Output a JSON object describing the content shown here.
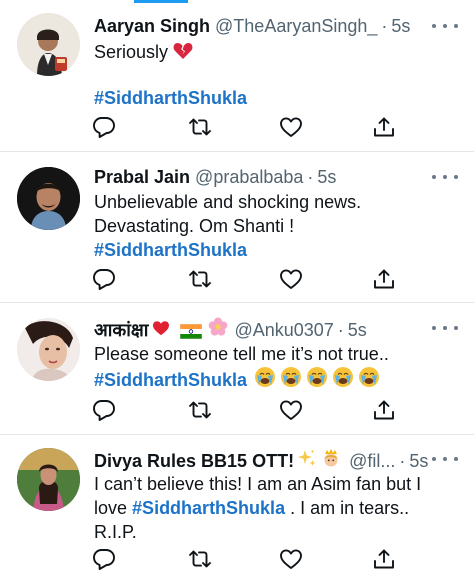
{
  "tweets": [
    {
      "name": "Aaryan Singh",
      "handle": "@TheAaryanSingh_",
      "time": "5s",
      "line1": "Seriously",
      "hashtag": "#SiddharthShukla",
      "avatar": "avatar-photo"
    },
    {
      "name": "Prabal Jain",
      "handle": "@prabalbaba",
      "time": "5s",
      "line1": "Unbelievable and shocking news.",
      "line2": "Devastating. Om Shanti !",
      "hashtag": "#SiddharthShukla",
      "avatar": "avatar-photo"
    },
    {
      "name": "आकांक्षा",
      "handle": "@Anku0307",
      "time": "5s",
      "line1": "Please someone tell me it’s not true..",
      "hashtag": "#SiddharthShukla",
      "avatar": "avatar-photo"
    },
    {
      "name": "Divya Rules BB15 OTT!",
      "handle": "@fil...",
      "time": "5s",
      "line1": "I can’t believe this! I am an Asim fan but I",
      "line2_pre": "love",
      "hashtag": "#SiddharthShukla",
      "line2_post": ". I am in tears..",
      "line3": "R.I.P.",
      "avatar": "avatar-photo"
    }
  ],
  "separator": "·",
  "icons": {
    "reply": "reply-icon",
    "retweet": "retweet-icon",
    "like": "heart-icon",
    "share": "share-icon",
    "more": "more-icon"
  },
  "colors": {
    "hashtag": "#1d73c7",
    "muted": "#536471",
    "accent": "#1d9bf0"
  }
}
